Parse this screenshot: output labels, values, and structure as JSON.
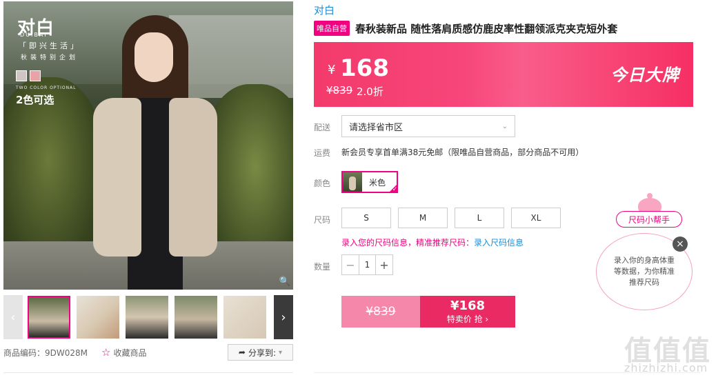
{
  "gallery": {
    "brand_logo": "对白",
    "brand_logo_sub": "DUIBAI",
    "slogan": "「即兴生活」",
    "slogan_sub": "秋装特别企划",
    "two_color_en": "TWO COLOR OPTIONAL",
    "two_color": "2色可选",
    "swatch_colors": [
      "#cfc6c4",
      "#e7a3a7"
    ],
    "thumbnails": [
      "thumb-1",
      "thumb-2",
      "thumb-3",
      "thumb-4",
      "thumb-5",
      "thumb-6"
    ]
  },
  "meta": {
    "product_code": "商品编码：9DW028M",
    "favorite": "收藏商品",
    "share": "分享到:"
  },
  "product": {
    "brand": "对白",
    "tag": "唯品自营",
    "title": "春秋装新品 随性落肩质感仿鹿皮率性翻领派克夹克短外套"
  },
  "price_banner": {
    "currency": "¥",
    "price": "168",
    "original_price": "¥839",
    "discount": "2.0折",
    "promo": "今日大牌"
  },
  "delivery": {
    "label": "配送",
    "select_value": "请选择省市区"
  },
  "shipping": {
    "label": "运费",
    "text": "新会员专享首单满38元免邮（限唯品自营商品，部分商品不可用）"
  },
  "color": {
    "label": "颜色",
    "option": "米色"
  },
  "size": {
    "label": "尺码",
    "options": [
      "S",
      "M",
      "L",
      "XL"
    ],
    "hint": "录入您的尺码信息，精准推荐尺码：",
    "hint_link": "录入尺码信息"
  },
  "quantity": {
    "label": "数量",
    "minus": "−",
    "value": "1",
    "plus": "+"
  },
  "buy_bar": {
    "original": "¥839",
    "price": "¥168",
    "cta": "特卖价 抢 ›"
  },
  "size_helper": {
    "label": "尺码小帮手",
    "bubble": "录入你的身高体重等数据，为你精准推荐尺码",
    "close": "×"
  },
  "watermark": {
    "text": "值值值",
    "url": "zhizhizhi.com"
  }
}
